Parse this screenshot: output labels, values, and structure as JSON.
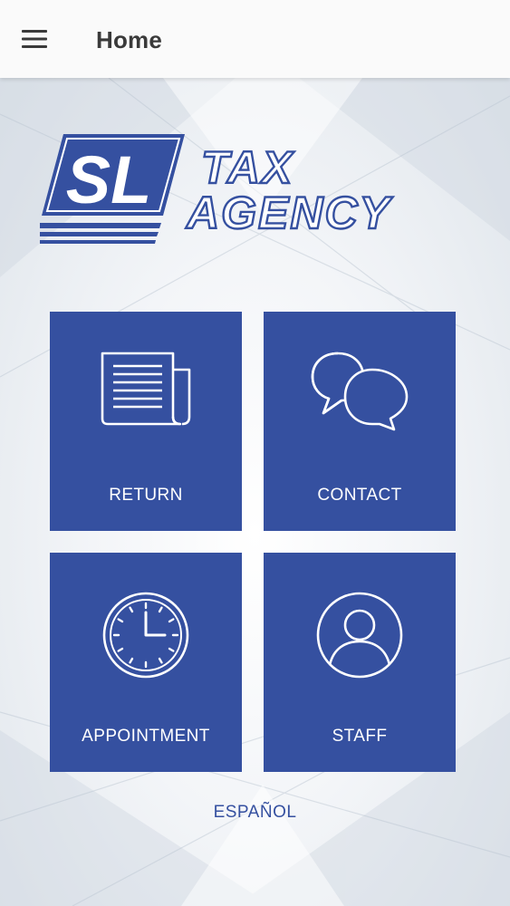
{
  "app_bar": {
    "title": "Home",
    "menu_icon": "hamburger-menu-icon"
  },
  "logo": {
    "initials": "SL",
    "line1": "TAX",
    "line2": "AGENCY",
    "brand_color": "#3550a0"
  },
  "tiles": [
    {
      "label": "RETURN",
      "icon": "document-icon"
    },
    {
      "label": "CONTACT",
      "icon": "speech-bubbles-icon"
    },
    {
      "label": "APPOINTMENT",
      "icon": "clock-icon"
    },
    {
      "label": "STAFF",
      "icon": "person-icon"
    }
  ],
  "language_link": {
    "label": "ESPAÑOL"
  },
  "colors": {
    "tile_background": "#3550a0",
    "tile_text": "#ffffff",
    "app_bar_background": "#fafafa",
    "app_bar_text": "#3a3a3a"
  }
}
